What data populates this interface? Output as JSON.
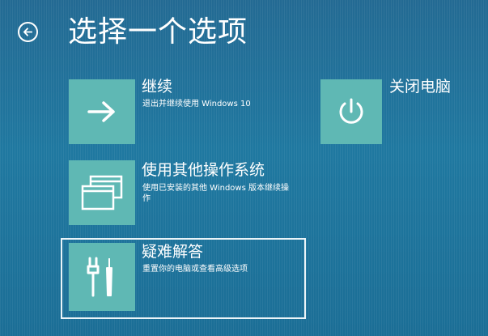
{
  "header": {
    "title": "选择一个选项"
  },
  "options": [
    {
      "title": "继续",
      "description": "退出并继续使用 Windows 10",
      "icon": "arrow-right-icon"
    },
    {
      "title": "使用其他操作系统",
      "description": "使用已安装的其他 Windows 版本继续操作",
      "icon": "windows-stack-icon"
    },
    {
      "title": "疑难解答",
      "description": "重置你的电脑或查看高级选项",
      "icon": "tools-icon",
      "selected": true
    },
    {
      "title": "关闭电脑",
      "icon": "power-icon"
    }
  ],
  "colors": {
    "background": "#1e6e96",
    "tile": "#5fb8b4",
    "text": "#ffffff"
  }
}
